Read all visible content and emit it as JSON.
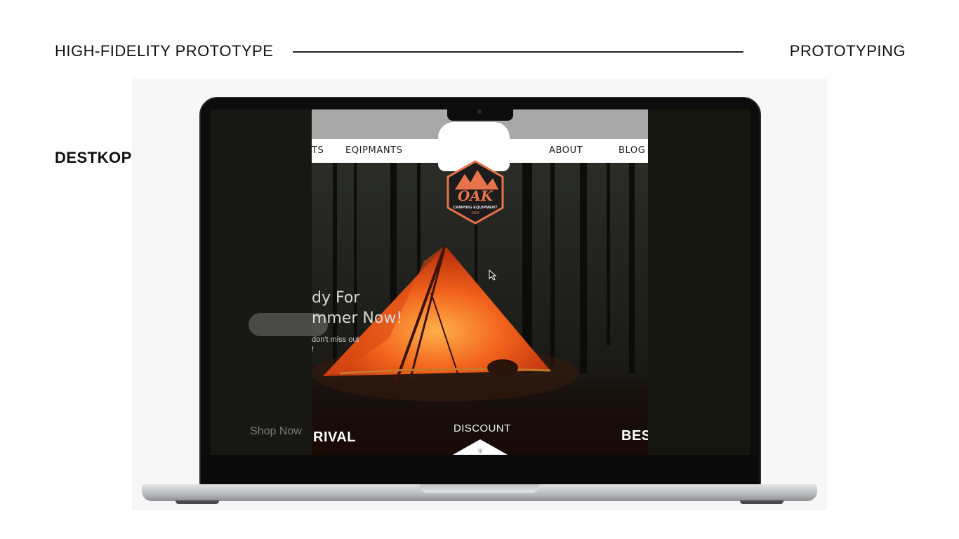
{
  "slide": {
    "title": "HIGH-FIDELITY PROTOTYPE",
    "section": "PROTOTYPING",
    "device_label": "DESTKOP"
  },
  "website": {
    "nav": {
      "left_fragment": "TS",
      "equipments": "EQIPMANTS",
      "about": "ABOUT",
      "blog": "BLOG"
    },
    "logo": {
      "brand": "OAK",
      "tagline": "CAMPING EQUIPMENT",
      "year": "1993"
    },
    "hero": {
      "line1_fragment": "dy  For",
      "line2_fragment": "mmer Now!",
      "sub1_fragment": "don't miss out",
      "sub2_fragment": "!"
    },
    "ghost_button_text": "Shop Now",
    "categories": {
      "left_fragment": "RIVAL",
      "center": "DISCOUNT",
      "right_fragment": "BES"
    },
    "colors": {
      "accent": "#e8734a",
      "tent": "#f05a1e"
    }
  }
}
